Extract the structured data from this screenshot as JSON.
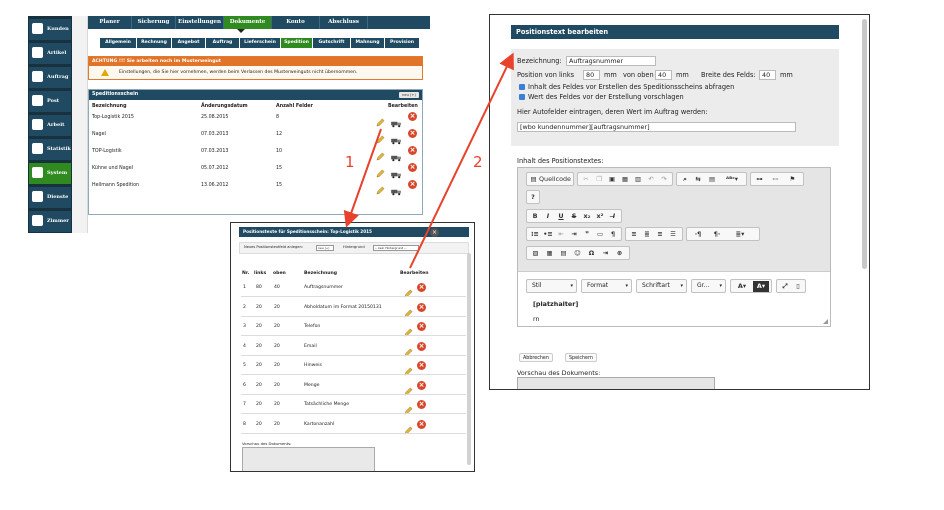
{
  "sidebar": {
    "items": [
      {
        "label": "Kunden",
        "icon": "user-icon",
        "active": false
      },
      {
        "label": "Artikel",
        "icon": "bottle-icon",
        "active": false
      },
      {
        "label": "Auftrag",
        "icon": "document-icon",
        "active": false
      },
      {
        "label": "Post",
        "icon": "mail-icon",
        "active": false
      },
      {
        "label": "Arbeit",
        "icon": "tractor-icon",
        "active": false
      },
      {
        "label": "Statistik",
        "icon": "chart-icon",
        "active": false
      },
      {
        "label": "System",
        "icon": "gear-icon",
        "active": true
      },
      {
        "label": "Dienste",
        "icon": "barrel-icon",
        "active": false
      },
      {
        "label": "Zimmer",
        "icon": "bed-icon",
        "active": false
      }
    ]
  },
  "topnav": [
    "Planer",
    "Sicherung",
    "Einstellungen",
    "Dokumente",
    "Konto",
    "Abschluss"
  ],
  "subnav": [
    "Allgemein",
    "Rechnung",
    "Angebot",
    "Auftrag",
    "Lieferschein",
    "Spedition",
    "Gutschrift",
    "Mahnung",
    "Provision"
  ],
  "warning": {
    "title": "ACHTUNG !!! Sie arbeiten noch im Musterweingut",
    "text": "Einstellungen, die Sie hier vornehmen, werden beim Verlassen des Musterweinguts nicht übernommen."
  },
  "speditionsschein": {
    "title": "Speditionsschein",
    "button": "neu (+)",
    "headers": [
      "Bezeichnung",
      "Änderungsdatum",
      "Anzahl Felder",
      "Bearbeiten"
    ],
    "rows": [
      {
        "name": "Top-Logistik 2015",
        "date": "25.08.2015",
        "fields": "8"
      },
      {
        "name": "Nagel",
        "date": "07.03.2013",
        "fields": "12"
      },
      {
        "name": "TOP-Logistik",
        "date": "07.03.2013",
        "fields": "10"
      },
      {
        "name": "Kühne und Nagel",
        "date": "05.07.2012",
        "fields": "15"
      },
      {
        "name": "Hellmann Spedition",
        "date": "13.06.2012",
        "fields": "15"
      }
    ]
  },
  "positionstexte": {
    "title": "Positionstexte für Speditionsschein: Top-Logistik 2015",
    "new_label": "Neues Positionstextfeld anlegen:",
    "new_button": "neu (+)",
    "bg_label": "Hintergrund",
    "bg_select": "-- kein Hintergrund --",
    "headers": [
      "Nr.",
      "links",
      "oben",
      "Bezeichnung",
      "Bearbeiten"
    ],
    "rows": [
      {
        "nr": "1",
        "links": "80",
        "oben": "40",
        "name": "Auftragsnummer"
      },
      {
        "nr": "2",
        "links": "20",
        "oben": "20",
        "name": "Abholdatum im Format 20150131"
      },
      {
        "nr": "3",
        "links": "20",
        "oben": "20",
        "name": "Telefon"
      },
      {
        "nr": "4",
        "links": "20",
        "oben": "20",
        "name": "Email"
      },
      {
        "nr": "5",
        "links": "20",
        "oben": "20",
        "name": "Hinweis"
      },
      {
        "nr": "6",
        "links": "20",
        "oben": "20",
        "name": "Menge"
      },
      {
        "nr": "7",
        "links": "20",
        "oben": "20",
        "name": "Tatsächliche Menge"
      },
      {
        "nr": "8",
        "links": "20",
        "oben": "20",
        "name": "Kartonanzahl"
      }
    ],
    "preview_label": "Vorschau des Dokuments:"
  },
  "edit": {
    "title": "Positionstext bearbeiten",
    "bezeichnung_label": "Bezeichnung:",
    "bezeichnung_value": "Auftragsnummer",
    "pos_links_label": "Position von links",
    "pos_links_value": "80",
    "unit_mm": "mm",
    "von_oben_label": "von oben",
    "von_oben_value": "40",
    "breite_label": "Breite des Felds:",
    "breite_value": "40",
    "checkbox1": "Inhalt des Feldes vor Erstellen des Speditionsscheins abfragen",
    "checkbox2": "Wert des Feldes vor der Erstellung vorschlagen",
    "autofelder_label": "Hier Autofelder eintragen, deren Wert im Auftrag werden:",
    "autofelder_value": "[wbo kundennummer][auftragsnummer]",
    "content_label": "Inhalt des Positionstextes:",
    "quellcode": "Quellcode",
    "dropdowns": [
      "Stil",
      "Format",
      "Schriftart",
      "Gr..."
    ],
    "content_placeholder": "[platzhalter]",
    "content_rn": "rn",
    "cancel": "Abbrechen",
    "save": "Speichern",
    "preview_label": "Vorschau des Dokuments:"
  },
  "annotations": {
    "arrow1": "1",
    "arrow2": "2"
  },
  "colors": {
    "nav": "#1f4a61",
    "active": "#2f8a20",
    "warning": "#e2742a",
    "arrow": "#e8412c"
  }
}
